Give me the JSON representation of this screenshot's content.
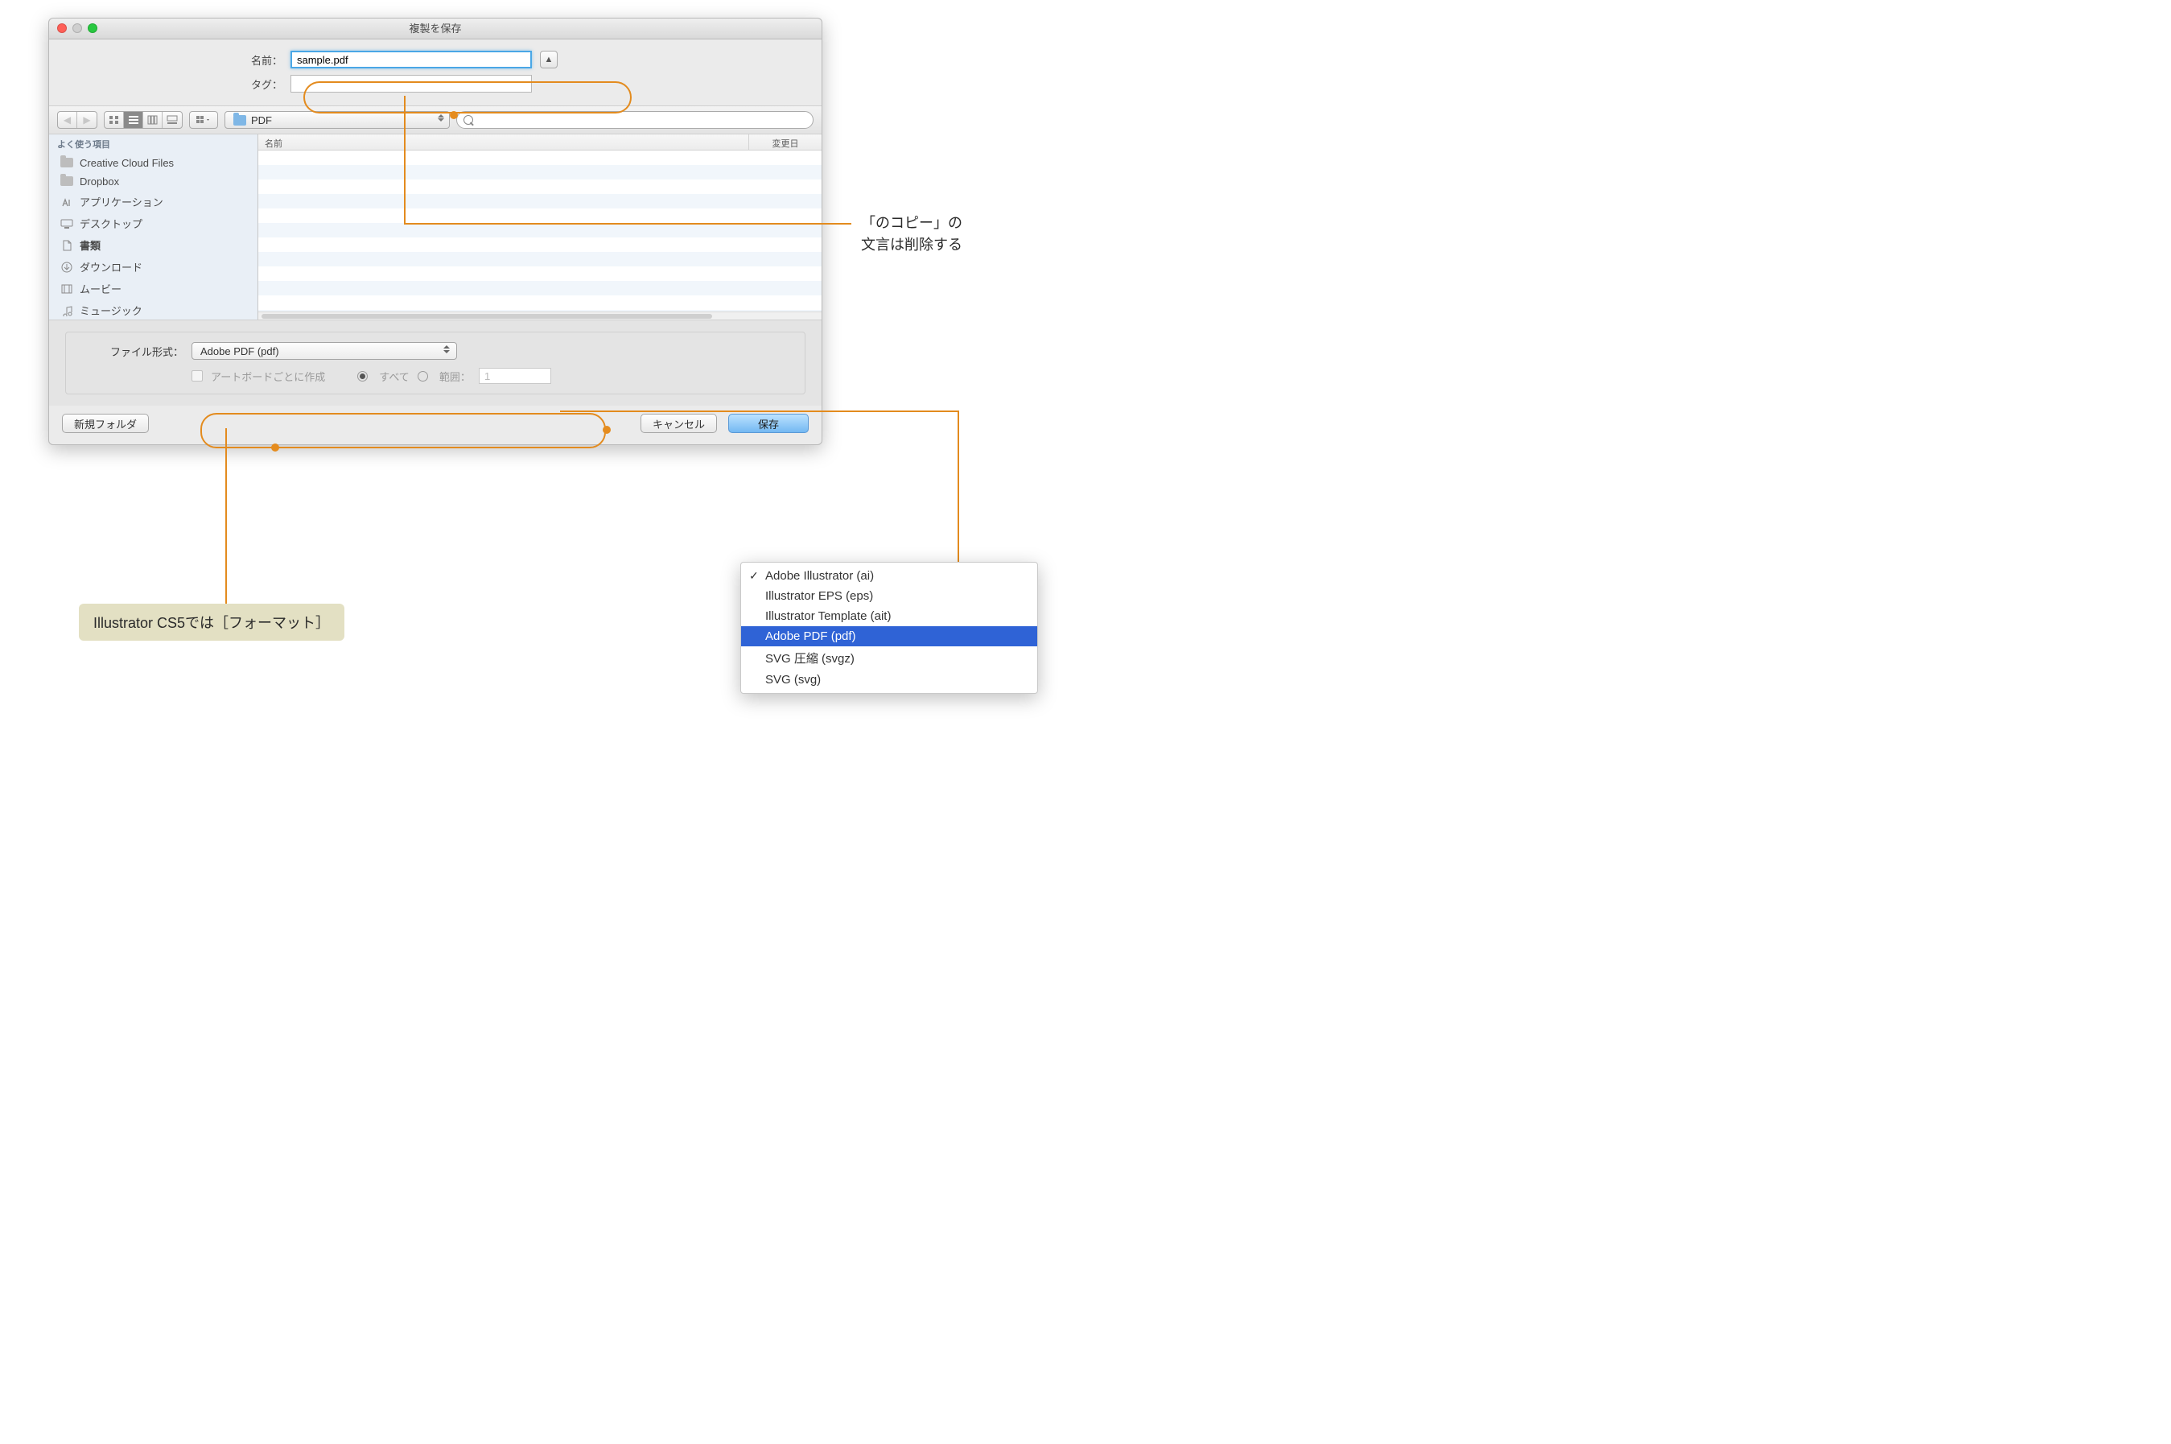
{
  "window": {
    "title": "複製を保存",
    "traffic_colors": [
      "#ff5f57",
      "#cfcfcf",
      "#28c840"
    ]
  },
  "fields": {
    "name_label": "名前：",
    "name_value": "sample.pdf",
    "tag_label": "タグ：",
    "tag_value": ""
  },
  "toolbar": {
    "folder_label": "PDF"
  },
  "sidebar": {
    "header": "よく使う項目",
    "items": [
      {
        "label": "Creative Cloud Files",
        "icon": "folder"
      },
      {
        "label": "Dropbox",
        "icon": "folder"
      },
      {
        "label": "アプリケーション",
        "icon": "apps"
      },
      {
        "label": "デスクトップ",
        "icon": "desktop"
      },
      {
        "label": "書類",
        "icon": "document",
        "selected": true
      },
      {
        "label": "ダウンロード",
        "icon": "download"
      },
      {
        "label": "ムービー",
        "icon": "movie"
      },
      {
        "label": "ミュージック",
        "icon": "music"
      }
    ]
  },
  "file_list": {
    "col_name": "名前",
    "col_date": "変更日"
  },
  "format": {
    "label": "ファイル形式：",
    "value": "Adobe PDF (pdf)",
    "checkbox_label": "アートボードごとに作成",
    "radio_all": "すべて",
    "radio_range": "範囲：",
    "range_value": "1"
  },
  "footer": {
    "new_folder": "新規フォルダ",
    "cancel": "キャンセル",
    "save": "保存"
  },
  "annotations": {
    "anno1_line1": "「のコピー」の",
    "anno1_line2": "文言は削除する",
    "note": "Illustrator CS5では［フォーマット］"
  },
  "dropdown": {
    "items": [
      {
        "label": "Adobe Illustrator (ai)",
        "checked": true
      },
      {
        "label": "Illustrator EPS (eps)"
      },
      {
        "label": "Illustrator Template (ait)"
      },
      {
        "label": "Adobe PDF (pdf)",
        "selected": true
      },
      {
        "label": "SVG 圧縮 (svgz)"
      },
      {
        "label": "SVG (svg)"
      }
    ]
  }
}
